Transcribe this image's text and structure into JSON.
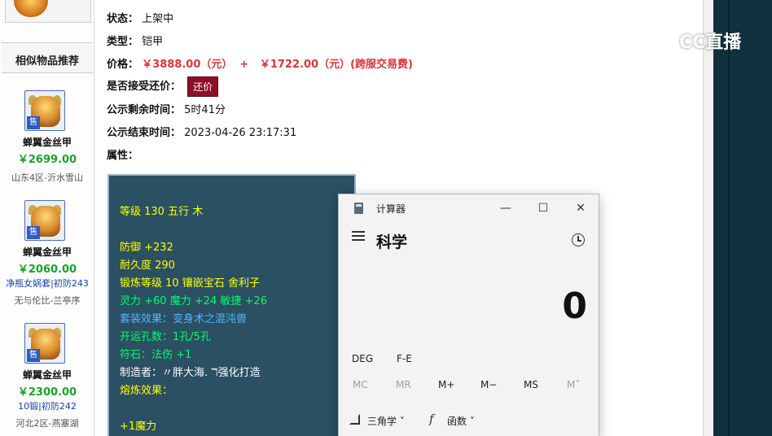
{
  "sidebar": {
    "title": "相似物品推荐",
    "items": [
      {
        "sell_badge": "售",
        "name": "蝉翼金丝甲",
        "price": "￥2699.00",
        "extra": "",
        "server": "山东4区-沂水雪山"
      },
      {
        "sell_badge": "售",
        "name": "蝉翼金丝甲",
        "price": "￥2060.00",
        "extra": "净瓶女娲套|初防243",
        "server": "无与伦比-兰亭序"
      },
      {
        "sell_badge": "售",
        "name": "蝉翼金丝甲",
        "price": "￥2300.00",
        "extra": "10锻|初防242",
        "server": "河北2区-燕塞湖"
      }
    ]
  },
  "details": {
    "status_label": "状态：",
    "status_value": "上架中",
    "type_label": "类型：",
    "type_value": "铠甲",
    "price_label": "价格：",
    "price_value": "￥3888.00（元）  +   ￥1722.00（元）(跨服交易费)",
    "bargain_label": "是否接受还价：",
    "bargain_button": "还价",
    "remaining_label": "公示剩余时间：",
    "remaining_value": "5时41分",
    "end_label": "公示结束时间：",
    "end_value": "2023-04-26 23:17:31",
    "attr_label": "属性："
  },
  "attributes": {
    "line1": "等级 130 五行 木",
    "line2": "防御 +232",
    "line3": "耐久度 290",
    "line4": "锻炼等级 10 镶嵌宝石 舍利子",
    "line5": "灵力 +60 魔力 +24 敏捷 +26",
    "line6": "套装效果：变身术之混沌兽",
    "line7": "开运孔数：1孔/5孔",
    "line8": "符石：法伤 +1",
    "line9": "制造者：〃胖大海. ℸ强化打造",
    "line10": "熔炼效果：",
    "line11": "+1魔力"
  },
  "calculator": {
    "title": "计算器",
    "min": "—",
    "max": "☐",
    "close": "✕",
    "mode": "科学",
    "display": "0",
    "deg": "DEG",
    "fe": "F-E",
    "mc": "MC",
    "mr": "MR",
    "mplus": "M+",
    "mminus": "M−",
    "ms": "MS",
    "mv": "M˅",
    "trig": "三角学 ˅",
    "func": "函数 ˅"
  },
  "watermark": {
    "text": "CC直播"
  },
  "colors": {
    "price_red": "#e0323a",
    "price_green": "#18a22a",
    "panel_bg": "#2b4f63",
    "bargain_btn": "#8f0e2a"
  }
}
